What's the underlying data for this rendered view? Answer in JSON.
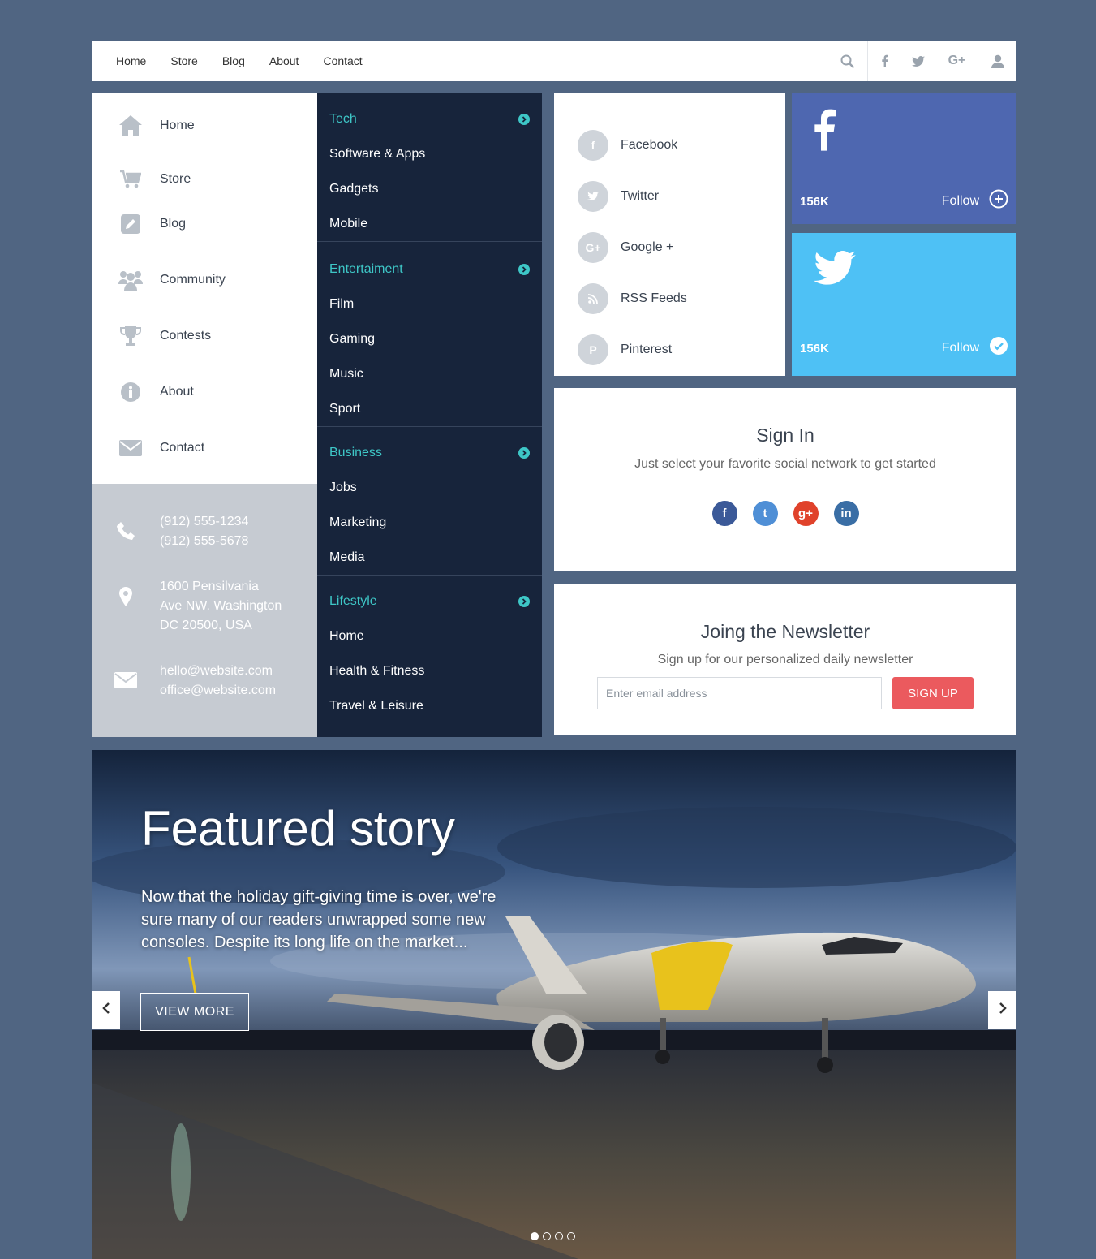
{
  "topnav": {
    "links": [
      "Home",
      "Store",
      "Blog",
      "About",
      "Contact"
    ],
    "icons": [
      "search-icon",
      "facebook-icon",
      "twitter-icon",
      "google-plus-icon",
      "user-icon"
    ]
  },
  "sidebar": {
    "items": [
      {
        "label": "Home",
        "icon": "home-icon"
      },
      {
        "label": "Store",
        "icon": "cart-icon"
      },
      {
        "label": "Blog",
        "icon": "pencil-icon"
      },
      {
        "label": "Community",
        "icon": "users-icon"
      },
      {
        "label": "Contests",
        "icon": "trophy-icon"
      },
      {
        "label": "About",
        "icon": "info-icon"
      },
      {
        "label": "Contact",
        "icon": "envelope-icon"
      }
    ]
  },
  "contact": {
    "phone1": "(912) 555-1234",
    "phone2": "(912) 555-5678",
    "addr1": "1600 Pensilvania",
    "addr2": "Ave NW. Washington",
    "addr3": "DC 20500, USA",
    "email1": "hello@website.com",
    "email2": "office@website.com"
  },
  "categories": [
    {
      "title": "Tech",
      "items": [
        "Software & Apps",
        "Gadgets",
        "Mobile"
      ]
    },
    {
      "title": "Entertaiment",
      "items": [
        "Film",
        "Gaming",
        "Music",
        "Sport"
      ]
    },
    {
      "title": "Business",
      "items": [
        "Jobs",
        "Marketing",
        "Media"
      ]
    },
    {
      "title": "Lifestyle",
      "items": [
        "Home",
        "Health & Fitness",
        "Travel & Leisure"
      ]
    }
  ],
  "social": {
    "items": [
      {
        "label": "Facebook",
        "icon": "facebook-icon"
      },
      {
        "label": "Twitter",
        "icon": "twitter-icon"
      },
      {
        "label": "Google +",
        "icon": "google-plus-icon"
      },
      {
        "label": "RSS Feeds",
        "icon": "rss-icon"
      },
      {
        "label": "Pinterest",
        "icon": "pinterest-icon"
      }
    ]
  },
  "follow": {
    "facebook": {
      "count": "156K",
      "label": "Follow",
      "color": "#4e67b0"
    },
    "twitter": {
      "count": "156K",
      "label": "Follow",
      "color": "#4ec1f5"
    }
  },
  "signin": {
    "title": "Sign In",
    "subtitle": "Just select your favorite social network to get started",
    "networks": [
      {
        "icon": "facebook-icon",
        "glyph": "f",
        "color": "#3b5998"
      },
      {
        "icon": "twitter-icon",
        "glyph": "t",
        "color": "#4f8fd6"
      },
      {
        "icon": "google-plus-icon",
        "glyph": "g+",
        "color": "#e0422b"
      },
      {
        "icon": "linkedin-icon",
        "glyph": "in",
        "color": "#3a6ea5"
      }
    ]
  },
  "newsletter": {
    "title": "Joing the Newsletter",
    "subtitle": "Sign up for our personalized daily newsletter",
    "placeholder": "Enter email address",
    "button": "SIGN UP",
    "button_color": "#eb5a5e"
  },
  "hero": {
    "title": "Featured story",
    "description": "Now that the holiday gift-giving time is over, we're sure many of our readers unwrapped some new consoles. Despite its long life on the market...",
    "button": "VIEW MORE",
    "slide_count": 4,
    "active_slide": 1
  }
}
